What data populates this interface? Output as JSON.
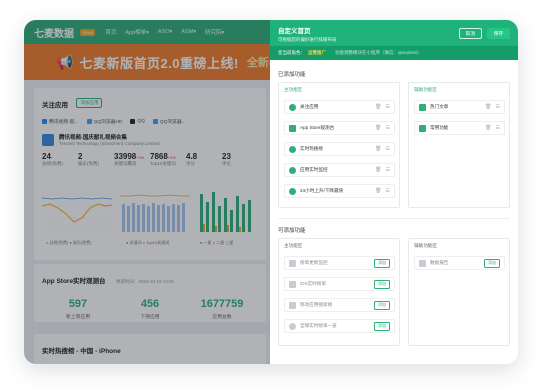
{
  "nav": {
    "logo": "七麦数据",
    "logo_badge": "QIMAI",
    "items": [
      "首页",
      "App榜单▾",
      "ASO▾",
      "ASM▾",
      "研究院▾"
    ]
  },
  "banner": {
    "text": "七麦新版首页2.0重磅上线!",
    "cta": "全新界"
  },
  "follow": {
    "title": "关注应用",
    "add_label": "添加应用",
    "tabs": [
      "腾讯视频-超...",
      "QQ浏览器HD",
      "QQ",
      "QQ浏览器..."
    ],
    "app_name": "腾讯视频-国庆献礼视频合集",
    "app_dev": "Tencent Technology (Shenzhen) Company Limited",
    "stats": [
      {
        "value": "24",
        "sup": "↑",
        "label": "总榜(免费)"
      },
      {
        "value": "2",
        "sup": "",
        "label": "娱乐(免费)"
      },
      {
        "value": "33998",
        "sup": "+3%",
        "label": "关键词覆盖"
      },
      {
        "value": "7868",
        "sup": "+3%",
        "label": "Top10关键词"
      },
      {
        "value": "4.8",
        "sup": "",
        "label": "评分"
      },
      {
        "value": "23",
        "sup": "",
        "label": "评论"
      }
    ],
    "legends": [
      "总榜(免费)",
      "娱乐(免费)",
      "关键词",
      "Top10关键词",
      "一星",
      "二星",
      "三星"
    ]
  },
  "realtime": {
    "title": "App Store实时观测台",
    "updated": "更新时间：2019-10-18 14:02",
    "items": [
      {
        "num": "597",
        "label": "新上架应用"
      },
      {
        "num": "456",
        "label": "下架应用"
      },
      {
        "num": "1677759",
        "label": "应用总数"
      }
    ]
  },
  "hotlist": {
    "title": "实时热搜榜 - 中国 - iPhone"
  },
  "panel": {
    "title": "自定义首页",
    "subtitle": "可根据您的偏好进行排版布局",
    "cancel": "取消",
    "save": "保存",
    "notice_prefix": "您当前角色：",
    "notice_role": "运营推广",
    "notice_sub": "功能调整模块在小程序（微信：qimaimini）",
    "added_title": "已添加功能",
    "main_block": "主功能区",
    "aux_block": "辅助功能区",
    "main_items": [
      "关注应用",
      "App Store观测台",
      "实时热搜榜",
      "应用实时监控",
      "24小时上升/下降最快"
    ],
    "aux_items": [
      "热门文章",
      "常用功能"
    ],
    "available_title": "可添加功能",
    "avail_main": [
      "榜单更新监控",
      "iOS实时榜单",
      "移动应用搜索榜",
      "全球实时榜单一览"
    ],
    "avail_aux": [
      "数据报告"
    ],
    "add_label": "添加"
  }
}
